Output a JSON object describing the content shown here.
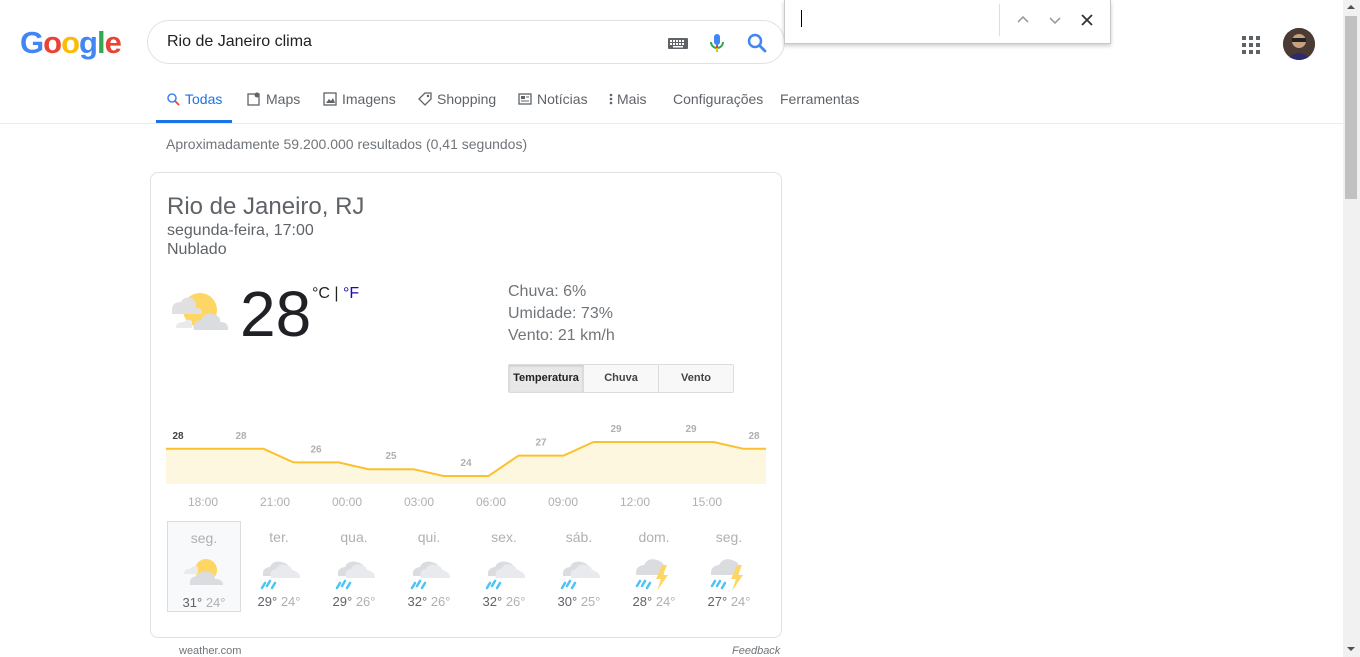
{
  "logo": {
    "letters": [
      "G",
      "o",
      "o",
      "g",
      "l",
      "e"
    ],
    "colors": [
      "#4285f4",
      "#ea4335",
      "#fbbc05",
      "#4285f4",
      "#34a853",
      "#ea4335"
    ]
  },
  "search": {
    "query": "Rio de Janeiro clima"
  },
  "tabs": [
    {
      "label": "Todas",
      "icon": "search-icon"
    },
    {
      "label": "Maps",
      "icon": "map-icon"
    },
    {
      "label": "Imagens",
      "icon": "image-icon"
    },
    {
      "label": "Shopping",
      "icon": "tag-icon"
    },
    {
      "label": "Notícias",
      "icon": "news-icon"
    },
    {
      "label": "Mais",
      "icon": "more-vertical-icon"
    },
    {
      "label": "Configurações"
    },
    {
      "label": "Ferramentas"
    }
  ],
  "stats": "Aproximadamente 59.200.000 resultados (0,41 segundos)",
  "weather": {
    "location": "Rio de Janeiro, RJ",
    "datetime": "segunda-feira, 17:00",
    "condition": "Nublado",
    "temp": "28",
    "unit_c": "°C",
    "unit_sep": " | ",
    "unit_f": "°F",
    "rain": "Chuva: 6%",
    "humidity": "Umidade: 73%",
    "wind": "Vento: 21 km/h",
    "seg_buttons": [
      "Temperatura",
      "Chuva",
      "Vento"
    ],
    "source": "weather.com",
    "feedback": "Feedback"
  },
  "chart_data": {
    "type": "area",
    "values": [
      28,
      28,
      26,
      25,
      24,
      27,
      29,
      29,
      28
    ],
    "labels": [
      "28",
      "28",
      "26",
      "25",
      "24",
      "27",
      "29",
      "29",
      "28"
    ],
    "x": [
      "18:00",
      "21:00",
      "00:00",
      "03:00",
      "06:00",
      "09:00",
      "12:00",
      "15:00"
    ],
    "color": "#fbc02d",
    "fill": "#fef7e0"
  },
  "forecast": [
    {
      "day": "seg.",
      "hi": "31°",
      "lo": "24°",
      "icon": "partly-cloudy-icon"
    },
    {
      "day": "ter.",
      "hi": "29°",
      "lo": "24°",
      "icon": "rain-icon"
    },
    {
      "day": "qua.",
      "hi": "29°",
      "lo": "26°",
      "icon": "rain-icon"
    },
    {
      "day": "qui.",
      "hi": "32°",
      "lo": "26°",
      "icon": "rain-icon"
    },
    {
      "day": "sex.",
      "hi": "32°",
      "lo": "26°",
      "icon": "rain-icon"
    },
    {
      "day": "sáb.",
      "hi": "30°",
      "lo": "25°",
      "icon": "rain-icon"
    },
    {
      "day": "dom.",
      "hi": "28°",
      "lo": "24°",
      "icon": "thunderstorm-icon"
    },
    {
      "day": "seg.",
      "hi": "27°",
      "lo": "24°",
      "icon": "thunderstorm-icon"
    }
  ]
}
